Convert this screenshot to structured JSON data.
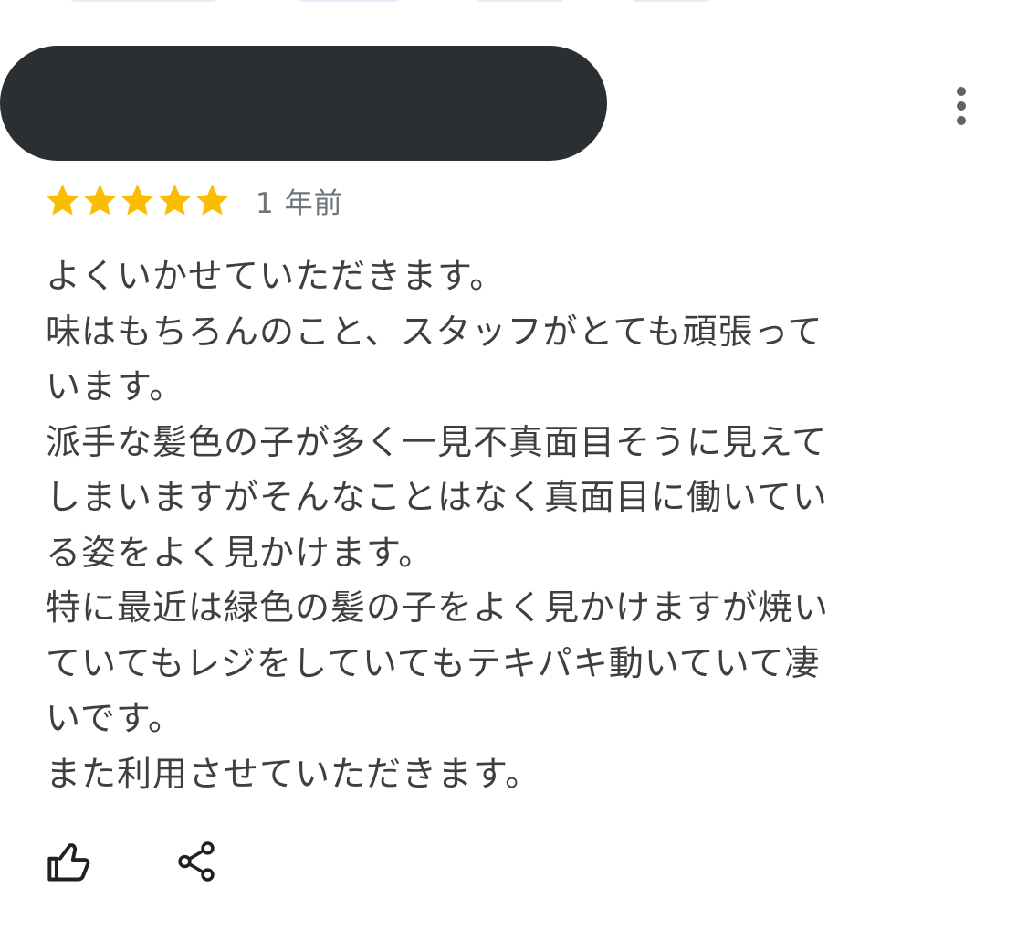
{
  "review": {
    "rating": 5,
    "rating_max": 5,
    "time_ago": "1 年前",
    "text_lines": [
      "よくいかせていただきます。",
      "味はもちろんのこと、スタッフがとても頑張って",
      "います。",
      "派手な髪色の子が多く一見不真面目そうに見えて",
      "しまいますがそんなことはなく真面目に働いてい",
      "る姿をよく見かけます。",
      "特に最近は緑色の髪の子をよく見かけますが焼い",
      "ていてもレジをしていてもテキパキ動いていて凄",
      "いです。",
      "また利用させていただきます。"
    ]
  },
  "icons": {
    "more": "more-vert-icon",
    "star": "star-icon",
    "like": "thumb-up-icon",
    "share": "share-icon"
  },
  "colors": {
    "star": "#fbbc04",
    "redaction": "#2b2f33",
    "text": "#3c4043",
    "secondary_text": "#70757a",
    "icon": "#202124"
  }
}
